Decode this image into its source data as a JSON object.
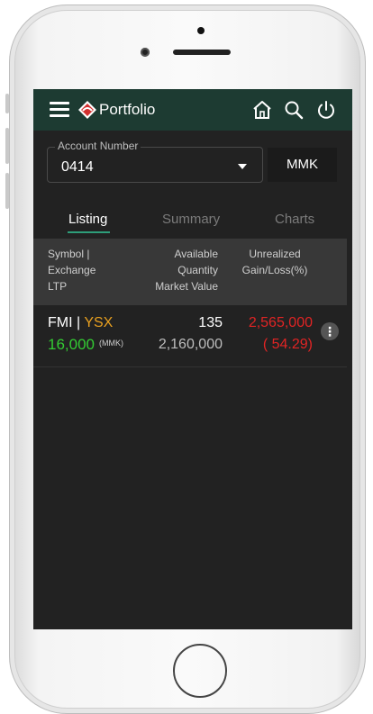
{
  "appbar": {
    "title": "Portfolio",
    "icons": [
      "menu-icon",
      "logo-icon",
      "home-icon",
      "search-icon",
      "power-icon"
    ]
  },
  "account": {
    "label": "Account Number",
    "value": "0414",
    "currency": "MMK"
  },
  "tabs": [
    {
      "label": "Listing",
      "active": true
    },
    {
      "label": "Summary",
      "active": false
    },
    {
      "label": "Charts",
      "active": false
    }
  ],
  "table": {
    "headers": {
      "symbol": [
        "Symbol |",
        "Exchange",
        "LTP"
      ],
      "quantity": [
        "Available",
        "Quantity",
        "Market Value"
      ],
      "gain": [
        "Unrealized",
        "Gain/Loss(%)"
      ]
    },
    "rows": [
      {
        "symbol": "FMI",
        "separator": "|",
        "exchange": "YSX",
        "ltp": "16,000",
        "ltp_currency": "(MMK)",
        "quantity": "135",
        "market_value": "2,160,000",
        "gain": "2,565,000",
        "gain_pct": "( 54.29)",
        "more": "⋮"
      }
    ]
  },
  "colors": {
    "appbar": "#1d3b32",
    "accent": "#2e9e7a",
    "exchange": "#e8a020",
    "ltp": "#33cc33",
    "loss": "#e02424"
  }
}
